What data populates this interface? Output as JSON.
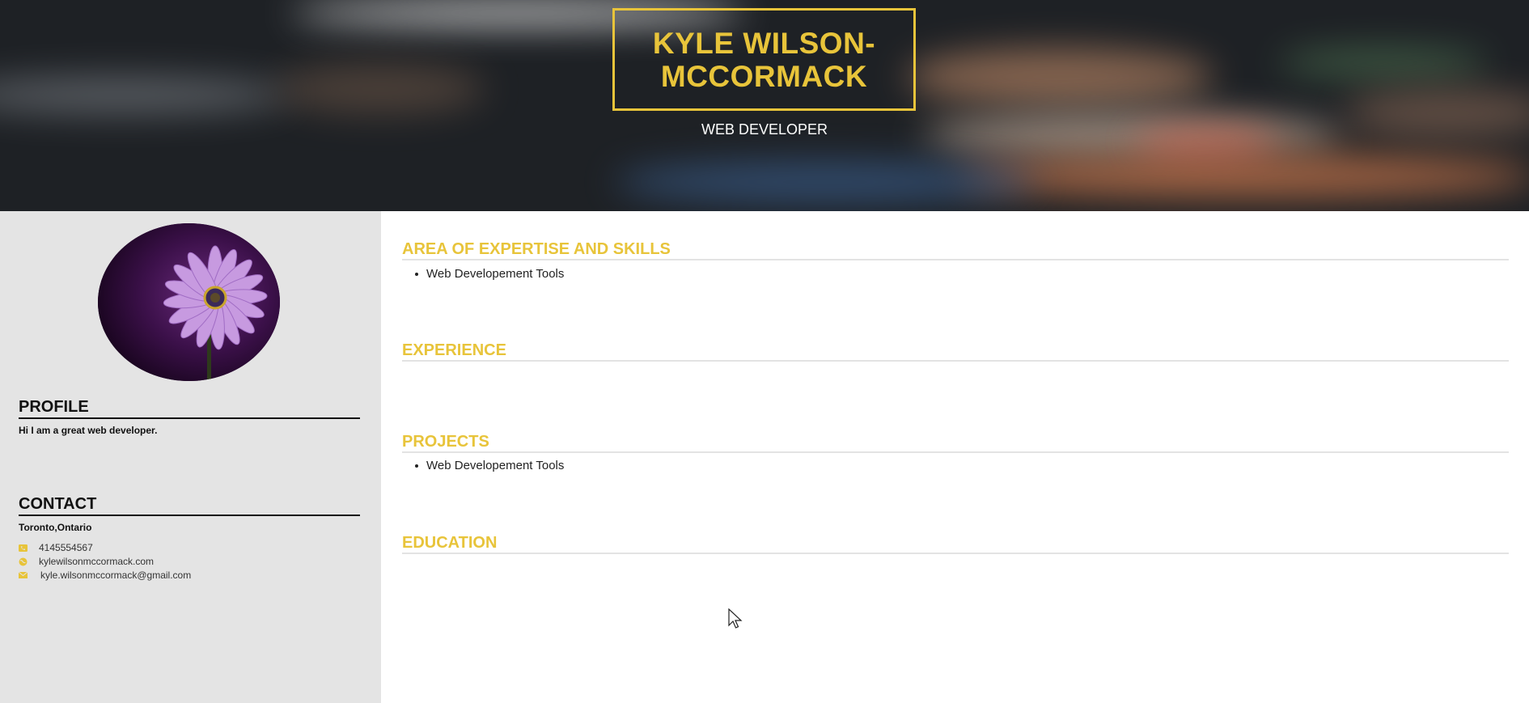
{
  "header": {
    "name": "KYLE WILSON-MCCORMACK",
    "title": "WEB DEVELOPER"
  },
  "sidebar": {
    "profile_heading": "PROFILE",
    "profile_text": "Hi I am a great web developer.",
    "contact_heading": "CONTACT",
    "location": "Toronto,Ontario",
    "contacts": [
      {
        "icon": "phone-icon",
        "value": "4145554567"
      },
      {
        "icon": "globe-icon",
        "value": "kylewilsonmccormack.com"
      },
      {
        "icon": "envelope-icon",
        "value": "kyle.wilsonmccormack@gmail.com"
      }
    ]
  },
  "main": {
    "sections": [
      {
        "heading": "AREA OF EXPERTISE AND SKILLS",
        "items": [
          "Web Developement Tools"
        ]
      },
      {
        "heading": "EXPERIENCE",
        "items": []
      },
      {
        "heading": "PROJECTS",
        "items": [
          "Web Developement Tools"
        ]
      },
      {
        "heading": "EDUCATION",
        "items": []
      }
    ]
  },
  "colors": {
    "accent": "#e8c43a",
    "header_bg": "#1e2125",
    "sidebar_bg": "#e4e4e4"
  }
}
